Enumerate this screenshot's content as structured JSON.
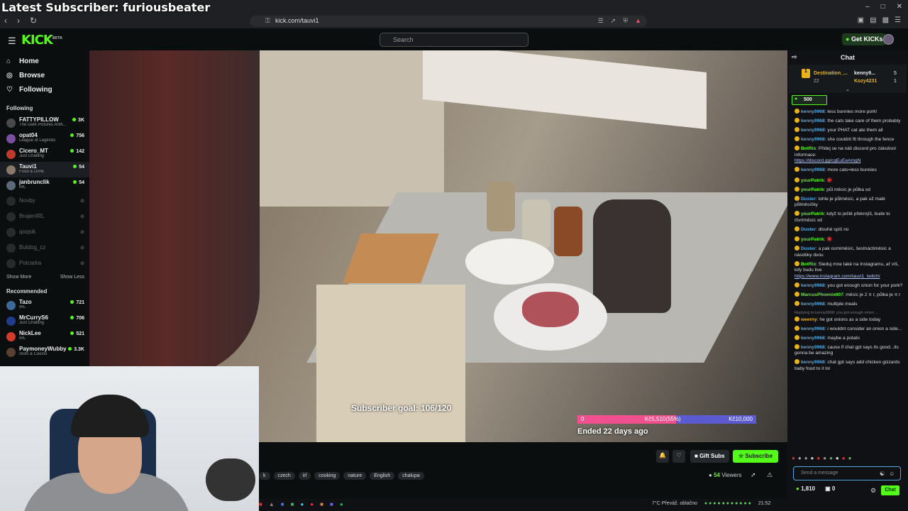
{
  "overlay_title": "Latest Subscriber: furiousbeater",
  "browser": {
    "url": "kick.com/tauvi1",
    "window_controls": [
      "–",
      "□",
      "✕"
    ],
    "nav": [
      "‹",
      "›",
      "↻"
    ]
  },
  "header": {
    "logo": "KICK",
    "logo_sup": "BETA",
    "search_placeholder": "Search",
    "get_kicks": "Get KICKs"
  },
  "sidebar": {
    "nav": [
      {
        "label": "Home",
        "icon": "home-icon"
      },
      {
        "label": "Browse",
        "icon": "compass-icon"
      },
      {
        "label": "Following",
        "icon": "heart-icon"
      }
    ],
    "following_title": "Following",
    "following": [
      {
        "name": "FATTYPILLOW",
        "category": "The Dark Pictures Anth...",
        "viewers": "3K",
        "color": "#4a4a4a",
        "live": true
      },
      {
        "name": "opat04",
        "category": "League of Legends",
        "viewers": "756",
        "color": "#7a4fa0",
        "live": true
      },
      {
        "name": "Cicero_MT",
        "category": "Just Chatting",
        "viewers": "142",
        "color": "#c0392b",
        "live": true
      },
      {
        "name": "Tauvi1",
        "category": "Food & Drink",
        "viewers": "54",
        "color": "#8a7a6a",
        "live": true
      },
      {
        "name": "janbrunclik",
        "category": "IRL",
        "viewers": "54",
        "color": "#5a6a7a",
        "live": true
      },
      {
        "name": "Novby",
        "category": "",
        "viewers": "",
        "color": "#555",
        "live": false
      },
      {
        "name": "BrajenIRL",
        "category": "",
        "viewers": "",
        "color": "#555",
        "live": false
      },
      {
        "name": "qoqsik",
        "category": "",
        "viewers": "",
        "color": "#555",
        "live": false
      },
      {
        "name": "Buldog_cz",
        "category": "",
        "viewers": "",
        "color": "#555",
        "live": false
      },
      {
        "name": "Polcarka",
        "category": "",
        "viewers": "",
        "color": "#555",
        "live": false
      }
    ],
    "show_more": "Show More",
    "show_less": "Show Less",
    "recommended_title": "Recommended",
    "recommended": [
      {
        "name": "Tazo",
        "category": "IRL",
        "viewers": "721",
        "color": "#3b6a9a"
      },
      {
        "name": "MrCurryS6",
        "category": "Just Chatting",
        "viewers": "706",
        "color": "#1f3b8a"
      },
      {
        "name": "NickLee",
        "category": "IRL",
        "viewers": "521",
        "color": "#d33a2a"
      },
      {
        "name": "PaymoneyWubby",
        "category": "Slots & Casino",
        "viewers": "3.3K",
        "color": "#5a4030"
      }
    ]
  },
  "video": {
    "subscriber_goal": "Subscriber goal: 106/120",
    "goal_start": "0",
    "goal_progress_label": "Kč5,510(55%)",
    "goal_end": "Kč10,000",
    "goal_fraction": 0.55,
    "ended": "Ended 22 days ago"
  },
  "controls": {
    "gift_subs": "Gift Subs",
    "subscribe": "Subscribe",
    "tags": [
      "k",
      "czech",
      "irl",
      "cooking",
      "nature",
      "English",
      "chalupa"
    ],
    "viewers_count": "54",
    "viewers_label": "Viewers"
  },
  "taskbar": {
    "weather": "7°C  Převáž. oblačno",
    "time": "21:52"
  },
  "chat": {
    "title": "Chat",
    "pinned_user": "Destination_...",
    "pinned_count": "22",
    "pinned_rank": "1",
    "top_users": [
      {
        "name": "kenny9...",
        "count": "5"
      },
      {
        "name": "Kozy4231",
        "count": "1"
      }
    ],
    "kicks_amount": "500",
    "messages": [
      {
        "user": "kenny9968",
        "color": "#53a8e0",
        "text": "less bunnies more pork!"
      },
      {
        "user": "kenny9968",
        "color": "#53a8e0",
        "text": "the cats take care of them probably"
      },
      {
        "user": "kenny9968",
        "color": "#53a8e0",
        "text": "your PHAT cat ate them all"
      },
      {
        "user": "kenny9968",
        "color": "#53a8e0",
        "text": "she couldnt fit through the fence"
      },
      {
        "user": "BotRix",
        "color": "#53fc18",
        "text": "Přidej se na náš discord pro zákulisní informace:",
        "link": "https://discord.gg/cgEuEeAmgN"
      },
      {
        "user": "kenny9968",
        "color": "#53a8e0",
        "text": "more cats=less bunnies"
      },
      {
        "user": "yourPatrik",
        "color": "#53fc18",
        "text": ""
      },
      {
        "user": "yourPatrik",
        "color": "#53fc18",
        "text": "půl měsíc je půlka xd"
      },
      {
        "user": "Duster",
        "color": "#53a8e0",
        "text": "tohle je půlměsíc, a pak už malé půlměsíčky"
      },
      {
        "user": "yourPatrik",
        "color": "#53fc18",
        "text": "když to ještě překrojíš, bude to čtvrtměsíc xd"
      },
      {
        "user": "Duster",
        "color": "#53a8e0",
        "text": "dlouhé spíš no"
      },
      {
        "user": "yourPatrik",
        "color": "#53fc18",
        "text": ""
      },
      {
        "user": "Duster",
        "color": "#53a8e0",
        "text": "a pak osmiměsíc, šestnáctiměsíc a násobky dvou"
      },
      {
        "user": "BotRix",
        "color": "#53fc18",
        "text": "Sleduj mne také na Instagramu, ať víš, kdy budu live",
        "link": "https://www.instagram.com/tauvi1_twitch/"
      },
      {
        "user": "kenny9968",
        "color": "#53a8e0",
        "text": "you got enough onion for your pork?"
      },
      {
        "user": "MarcusPhoenix007",
        "color": "#53fc18",
        "text": "měsíc je 2 π r, půlka je π r"
      },
      {
        "user": "kenny9968",
        "color": "#53a8e0",
        "text": "multiple meals"
      },
      {
        "user": "weerny",
        "color": "#e8b21a",
        "text": "he got onions as a side today",
        "reply": "Replying to kenny9968: you got enough onion ..."
      },
      {
        "user": "kenny9968",
        "color": "#53a8e0",
        "text": "i wouldnt consider an onion a side..."
      },
      {
        "user": "kenny9968",
        "color": "#53a8e0",
        "text": "maybe a potato"
      },
      {
        "user": "kenny9968",
        "color": "#53a8e0",
        "text": "cause if chat gpt says its good...its gonna be amazing"
      },
      {
        "user": "kenny9968",
        "color": "#53a8e0",
        "text": "chat gpt says add chicken gizzards baby food to it lol"
      }
    ],
    "send_placeholder": "Send a message",
    "balance": "1,810",
    "balance_b": "0",
    "chat_button": "Chat"
  }
}
